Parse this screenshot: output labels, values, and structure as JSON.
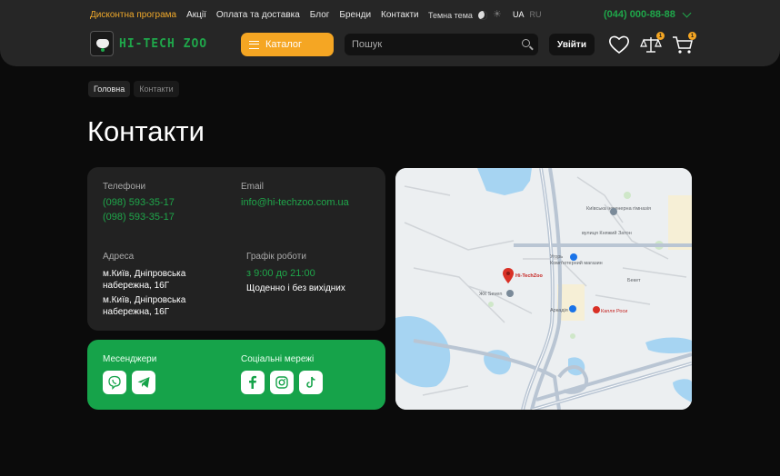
{
  "header": {
    "nav": [
      "Дисконтна програма",
      "Акції",
      "Оплата та доставка",
      "Блог",
      "Бренди",
      "Контакти"
    ],
    "theme_label": "Темна тема",
    "lang_active": "UA",
    "lang_inactive": "RU",
    "phone": "(044) 000-88-88",
    "logo_text": "HI-TECH ZOO",
    "catalog_label": "Каталог",
    "search_placeholder": "Пошук",
    "login_label": "Увійти",
    "compare_count": "1",
    "cart_count": "1"
  },
  "breadcrumbs": [
    "Головна",
    "Контакти"
  ],
  "page_title": "Контакти",
  "contacts": {
    "phones_label": "Телефони",
    "phones": [
      "(098) 593-35-17",
      "(098) 593-35-17"
    ],
    "email_label": "Email",
    "email": "info@hi-techzoo.com.ua",
    "address_label": "Адреса",
    "address_1": "м.Київ, Дніпровська набережна, 16Г",
    "address_2": "м.Київ, Дніпровська набережна, 16Г",
    "schedule_label": "Графік роботи",
    "hours": "з 9:00 до 21:00",
    "days": "Щоденно і без вихідних"
  },
  "social": {
    "messengers_label": "Месенджери",
    "networks_label": "Соціальні мережі"
  },
  "map": {
    "labels": [
      "Київська інженерна гімназія",
      "Угорь",
      "Комп'ютерний магазин",
      "Hi-TechZoo",
      "ЖК Seven",
      "Аркадія",
      "Капля Роси",
      "вулиця Княжий Затон",
      "Бекет"
    ]
  }
}
